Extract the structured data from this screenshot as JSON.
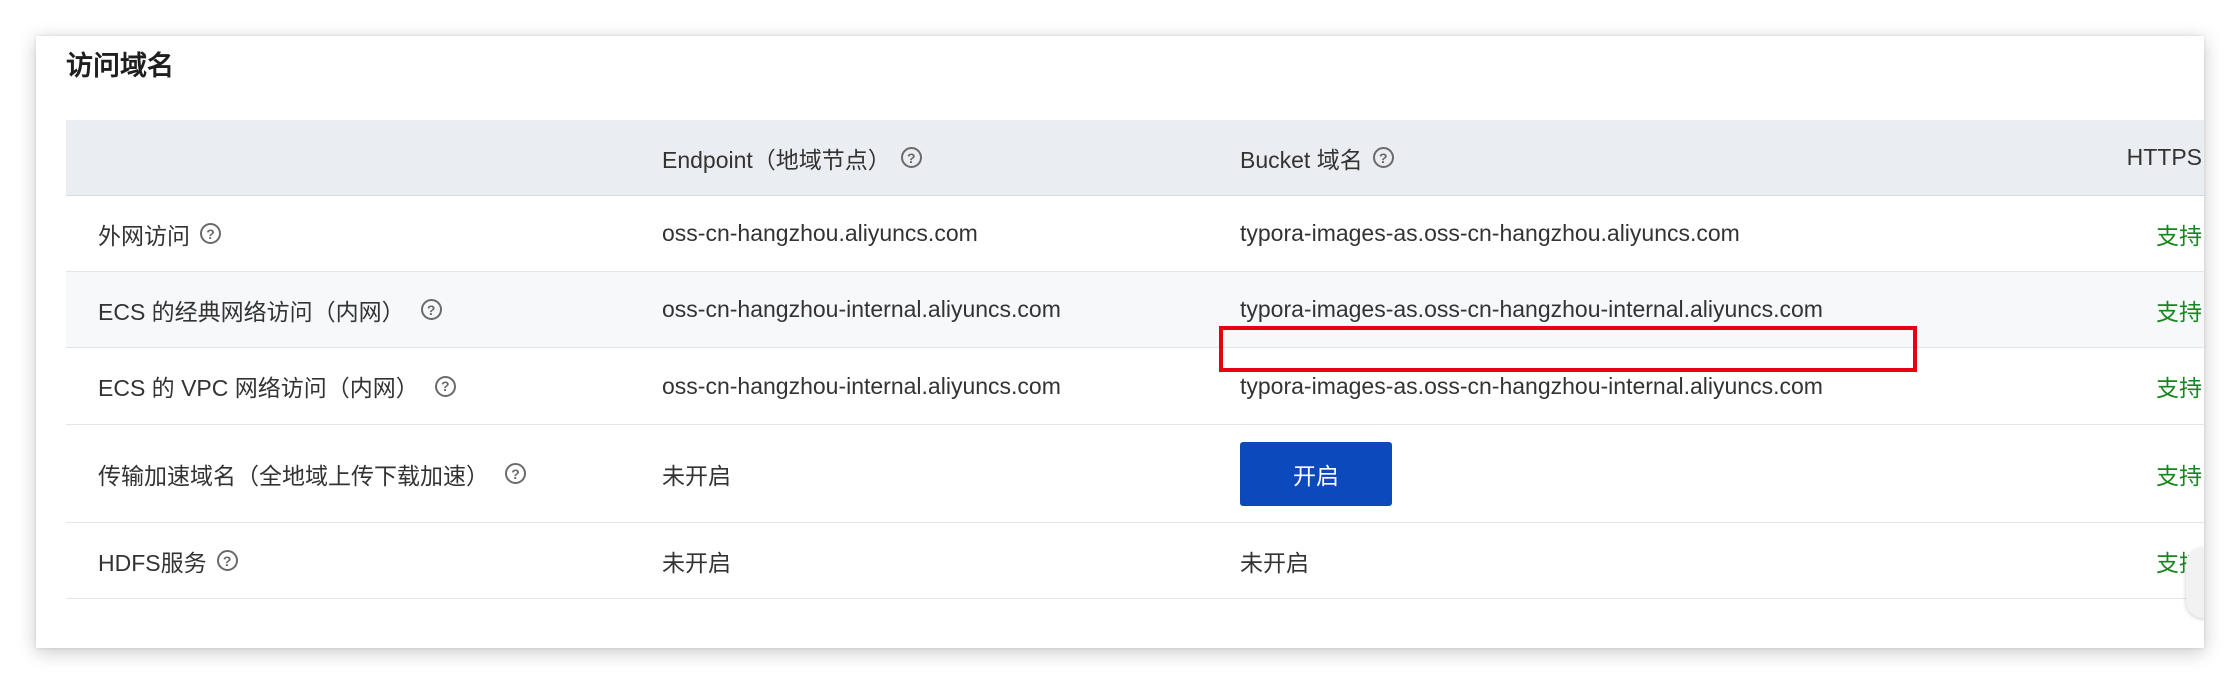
{
  "section": {
    "title": "访问域名"
  },
  "table": {
    "headers": {
      "name": "",
      "endpoint": "Endpoint（地域节点）",
      "bucket": "Bucket 域名",
      "https": "HTTPS"
    },
    "rows": [
      {
        "name": "外网访问",
        "endpoint": "oss-cn-hangzhou.aliyuncs.com",
        "bucket": "typora-images-as.oss-cn-hangzhou.aliyuncs.com",
        "https": "支持"
      },
      {
        "name": "ECS 的经典网络访问（内网）",
        "endpoint": "oss-cn-hangzhou-internal.aliyuncs.com",
        "bucket": "typora-images-as.oss-cn-hangzhou-internal.aliyuncs.com",
        "https": "支持",
        "highlighted": true
      },
      {
        "name": "ECS 的 VPC 网络访问（内网）",
        "endpoint": "oss-cn-hangzhou-internal.aliyuncs.com",
        "bucket": "typora-images-as.oss-cn-hangzhou-internal.aliyuncs.com",
        "https": "支持"
      },
      {
        "name": "传输加速域名（全地域上传下载加速）",
        "endpoint": "未开启",
        "bucket_button": "开启",
        "https": "支持"
      },
      {
        "name": "HDFS服务",
        "endpoint": "未开启",
        "bucket": "未开启",
        "https": "支持"
      }
    ]
  },
  "icons": {
    "help": "question-circle-icon"
  },
  "colors": {
    "header_bg": "#eaedf1",
    "support_green": "#16871f",
    "primary_button": "#0c49bd",
    "highlight_border": "#e60012"
  }
}
